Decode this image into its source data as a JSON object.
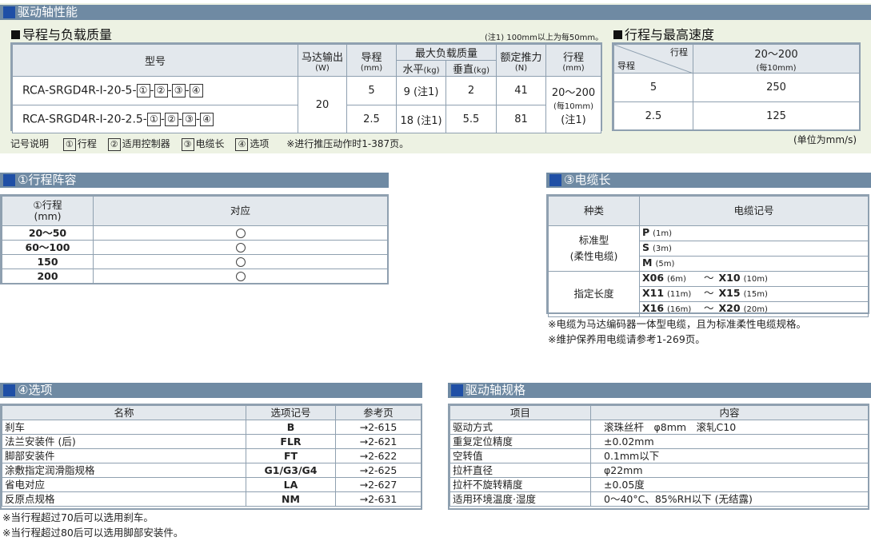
{
  "performance": {
    "title": "驱动轴性能",
    "stroke_load": {
      "title": "导程与负载质量",
      "note": "(注1) 100mm以上为每50mm。",
      "headers": {
        "model": "型号",
        "motor": "马达输出",
        "motor_unit": "(W)",
        "lead": "导程",
        "lead_unit": "(mm)",
        "max_load": "最大负载质量",
        "horizontal": "水平",
        "horizontal_unit": "(kg)",
        "vertical": "垂直",
        "vertical_unit": "(kg)",
        "thrust": "额定推力",
        "thrust_unit": "(N)",
        "stroke": "行程",
        "stroke_unit": "(mm)"
      },
      "rows": [
        {
          "model_prefix": "RCA-SRGD4R-I-20-5-",
          "lead": "5",
          "horizontal": "9 (注1)",
          "vertical": "2",
          "thrust": "41"
        },
        {
          "model_prefix": "RCA-SRGD4R-I-20-2.5-",
          "lead": "2.5",
          "horizontal": "18 (注1)",
          "vertical": "5.5",
          "thrust": "81"
        }
      ],
      "motor_value": "20",
      "stroke_value": "20～200",
      "stroke_sub": "(每10mm)",
      "stroke_note": "(注1)",
      "model_codes": [
        "①",
        "②",
        "③",
        "④"
      ],
      "model_sep": "-"
    },
    "speed": {
      "title": "行程与最高速度",
      "corner_top": "行程",
      "corner_bottom": "导程",
      "stroke_range": "20～200",
      "stroke_sub": "(每10mm)",
      "rows": [
        {
          "lead": "5",
          "speed": "250"
        },
        {
          "lead": "2.5",
          "speed": "125"
        }
      ],
      "unit": "(单位为mm/s)"
    },
    "legend": {
      "label": "记号说明",
      "items": [
        {
          "code": "①",
          "text": "行程"
        },
        {
          "code": "②",
          "text": "适用控制器"
        },
        {
          "code": "③",
          "text": "电缆长"
        },
        {
          "code": "④",
          "text": "选项"
        }
      ],
      "note": "※进行推压动作时1-387页。"
    }
  },
  "stroke_table": {
    "title": "①行程阵容",
    "header_stroke": "①行程",
    "header_unit": "(mm)",
    "header_support": "对应",
    "rows": [
      "20～50",
      "60～100",
      "150",
      "200"
    ],
    "mark": "○"
  },
  "cable": {
    "title": "③电缆长",
    "header_kind": "种类",
    "header_code": "电缆记号",
    "standard_label1": "标准型",
    "standard_label2": "(柔性电缆)",
    "custom_label": "指定长度",
    "standard": [
      {
        "code": "P",
        "len": "(1m)"
      },
      {
        "code": "S",
        "len": "(3m)"
      },
      {
        "code": "M",
        "len": "(5m)"
      }
    ],
    "custom": [
      {
        "a": "X06",
        "alen": "(6m)",
        "tilde": "～",
        "b": "X10",
        "blen": "(10m)"
      },
      {
        "a": "X11",
        "alen": "(11m)",
        "tilde": "～",
        "b": "X15",
        "blen": "(15m)"
      },
      {
        "a": "X16",
        "alen": "(16m)",
        "tilde": "～",
        "b": "X20",
        "blen": "(20m)"
      }
    ],
    "notes": [
      "※电缆为马达编码器一体型电缆，且为标准柔性电缆规格。",
      "※维护保养用电缆请参考1-269页。"
    ]
  },
  "options": {
    "title": "④选项",
    "headers": [
      "名称",
      "选项记号",
      "参考页"
    ],
    "rows": [
      [
        "刹车",
        "B",
        "→2-615"
      ],
      [
        "法兰安装件 (后)",
        "FLR",
        "→2-621"
      ],
      [
        "脚部安装件",
        "FT",
        "→2-622"
      ],
      [
        "涂敷指定润滑脂规格",
        "G1/G3/G4",
        "→2-625"
      ],
      [
        "省电对应",
        "LA",
        "→2-627"
      ],
      [
        "反原点规格",
        "NM",
        "→2-631"
      ]
    ],
    "notes": [
      "※当行程超过70后可以选用刹车。",
      "※当行程超过80后可以选用脚部安装件。"
    ]
  },
  "spec": {
    "title": "驱动轴规格",
    "headers": [
      "项目",
      "内容"
    ],
    "rows": [
      [
        "驱动方式",
        "滚珠丝杆　φ8mm　滚轧C10"
      ],
      [
        "重复定位精度",
        "±0.02mm"
      ],
      [
        "空转值",
        "0.1mm以下"
      ],
      [
        "拉杆直径",
        "φ22mm"
      ],
      [
        "拉杆不旋转精度",
        "±0.05度"
      ],
      [
        "适用环境温度·湿度",
        "0～40°C、85%RH以下 (无结露)"
      ]
    ]
  },
  "colors": {
    "header_bar": "#6f8aa3",
    "header_square": "#1f4fa6",
    "panel_bg": "#edf2e3",
    "table_head": "#e3e8ed",
    "border": "#8fa0b0"
  }
}
